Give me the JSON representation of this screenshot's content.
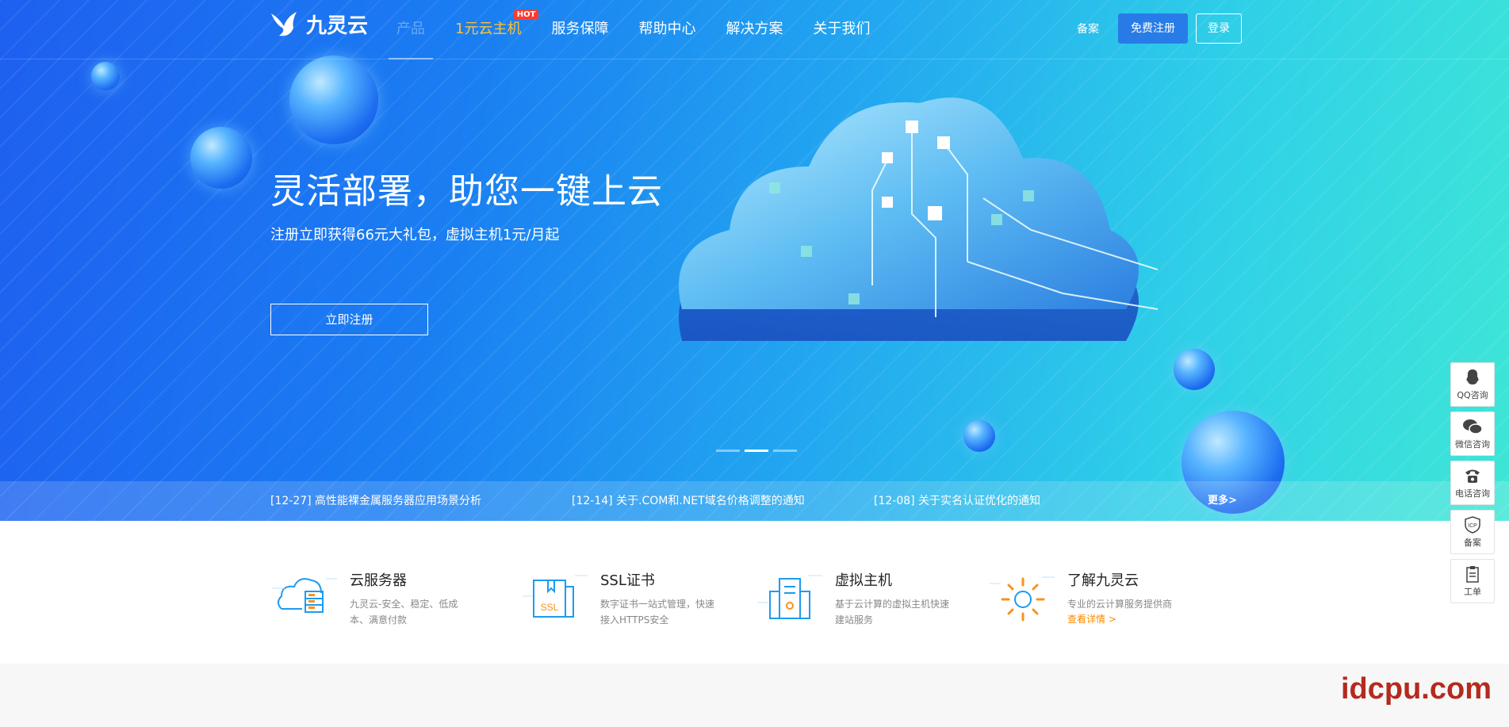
{
  "header": {
    "logo_text": "九灵云",
    "nav": [
      {
        "label": "产品"
      },
      {
        "label": "1元云主机",
        "badge": "HOT"
      },
      {
        "label": "服务保障"
      },
      {
        "label": "帮助中心"
      },
      {
        "label": "解决方案"
      },
      {
        "label": "关于我们"
      }
    ],
    "beian_link": "备案",
    "register_button": "免费注册",
    "login_button": "登录"
  },
  "hero": {
    "headline": "灵活部署，助您一键上云",
    "subline": "注册立即获得66元大礼包，虚拟主机1元/月起",
    "cta": "立即注册",
    "carousel": {
      "slides": 3,
      "active": 2
    }
  },
  "news": {
    "items": [
      "[12-27] 高性能裸金属服务器应用场景分析",
      "[12-14] 关于.COM和.NET域名价格调整的通知",
      "[12-08] 关于实名认证优化的通知"
    ],
    "more": "更多>"
  },
  "features": [
    {
      "title": "云服务器",
      "desc": "九灵云-安全、稳定、低成本、满意付款",
      "icon": "cloud-server-icon"
    },
    {
      "title": "SSL证书",
      "desc": "数字证书一站式管理，快速接入HTTPS安全",
      "icon": "ssl-certificate-icon",
      "icon_text": "SSL"
    },
    {
      "title": "虚拟主机",
      "desc": "基于云计算的虚拟主机快速建站服务",
      "icon": "virtual-host-icon"
    },
    {
      "title": "了解九灵云",
      "desc": "专业的云计算服务提供商",
      "link": "查看详情 >",
      "icon": "sun-icon"
    }
  ],
  "sidebar": [
    {
      "label": "QQ咨询",
      "icon": "qq-icon"
    },
    {
      "label": "微信咨询",
      "icon": "wechat-icon"
    },
    {
      "label": "电话咨询",
      "icon": "phone-icon"
    },
    {
      "label": "备案",
      "icon": "icp-icon",
      "icon_text": "ICP"
    },
    {
      "label": "工单",
      "icon": "ticket-icon"
    }
  ],
  "watermark": "idcpu.com",
  "colors": {
    "accent": "#1e6ff0",
    "promo": "#ffc333",
    "hot_badge": "#ff3b30",
    "link_orange": "#ff8a00",
    "icon_blue": "#1d9bf0",
    "icon_orange": "#f7931e"
  }
}
